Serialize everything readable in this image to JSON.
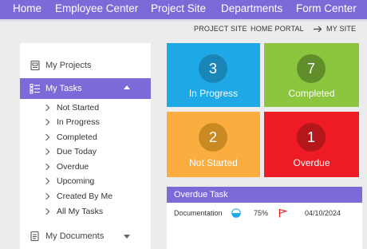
{
  "nav": {
    "items": [
      "Home",
      "Employee Center",
      "Project Site",
      "Departments",
      "Form Center"
    ]
  },
  "utility": {
    "project_site": "PROJECT SITE",
    "home_portal": "HOME PORTAL",
    "my_site": "MY SITE"
  },
  "sidebar": {
    "my_projects": "My Projects",
    "my_tasks": "My Tasks",
    "my_documents": "My Documents",
    "task_items": [
      "Not Started",
      "In Progress",
      "Completed",
      "Due Today",
      "Overdue",
      "Upcoming",
      "Created By Me",
      "All My Tasks"
    ]
  },
  "tiles": [
    {
      "count": "3",
      "label": "In Progress",
      "bg": "#1ea8e6",
      "circle": "#1a86b8"
    },
    {
      "count": "7",
      "label": "Completed",
      "bg": "#8cc63f",
      "circle": "#5f8e2b"
    },
    {
      "count": "2",
      "label": "Not Started",
      "bg": "#fbad3f",
      "circle": "#c98a24"
    },
    {
      "count": "1",
      "label": "Overdue",
      "bg": "#ed1c24",
      "circle": "#b3161b"
    }
  ],
  "overdue": {
    "title": "Overdue Task",
    "rows": [
      {
        "name": "Documentation",
        "progress": "75%",
        "date": "04/10/2024"
      }
    ]
  },
  "colors": {
    "accent": "#7b6ad8"
  }
}
